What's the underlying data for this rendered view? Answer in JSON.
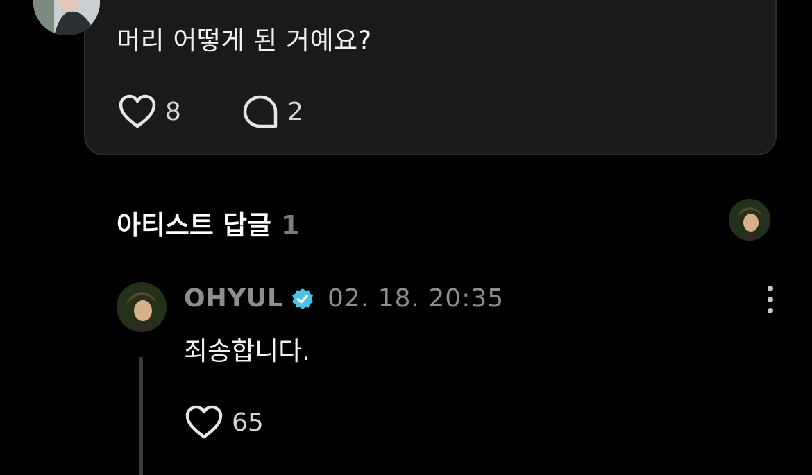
{
  "post": {
    "text": "머리 어떻게 된 거예요?",
    "like_count": "8",
    "comment_count": "2"
  },
  "section": {
    "title": "아티스트 답글",
    "count": "1"
  },
  "reply": {
    "author": "OHYUL",
    "timestamp": "02. 18. 20:35",
    "text": "죄송합니다.",
    "like_count": "65"
  },
  "icons": {
    "like": "heart-outline-icon",
    "comment": "speech-bubble-icon",
    "verified": "verified-badge-icon",
    "more": "more-vertical-icon"
  },
  "colors": {
    "background": "#000000",
    "card": "#1a1a1a",
    "text_primary": "#f2f2f2",
    "text_muted": "#8e8e8e",
    "verified": "#4cc3e6"
  }
}
